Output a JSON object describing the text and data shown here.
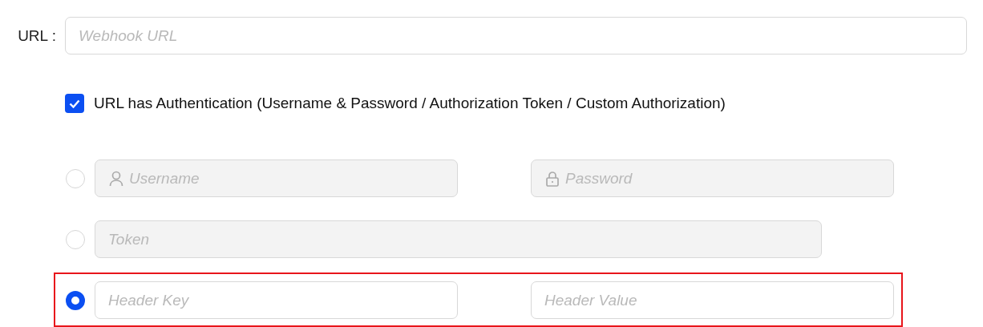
{
  "url": {
    "label": "URL :",
    "placeholder": "Webhook URL"
  },
  "authentication": {
    "checked": true,
    "label": "URL has Authentication (Username & Password / Authorization Token / Custom Authorization)"
  },
  "auth_options": [
    {
      "kind": "pair",
      "selected": false,
      "highlighted": false,
      "fields": [
        {
          "placeholder": "Username"
        },
        {
          "placeholder": "Password"
        }
      ]
    },
    {
      "kind": "single",
      "selected": false,
      "highlighted": false,
      "fields": [
        {
          "placeholder": "Token"
        }
      ]
    },
    {
      "kind": "pair",
      "selected": true,
      "highlighted": true,
      "fields": [
        {
          "placeholder": "Header Key"
        },
        {
          "placeholder": "Header Value"
        }
      ]
    }
  ]
}
